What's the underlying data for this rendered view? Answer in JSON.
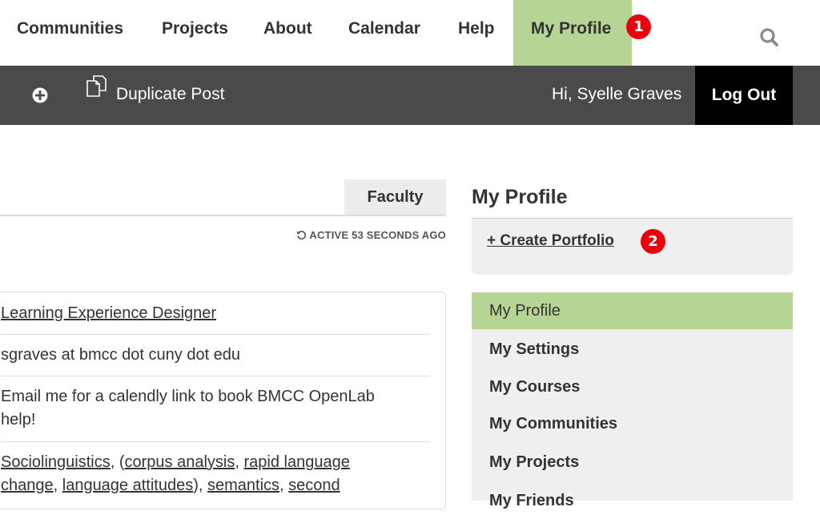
{
  "topnav": {
    "items": [
      {
        "label": "Communities"
      },
      {
        "label": "Projects"
      },
      {
        "label": "About"
      },
      {
        "label": "Calendar"
      },
      {
        "label": "Help"
      },
      {
        "label": "My Profile",
        "active": true
      }
    ],
    "profile_badge": "1",
    "search_icon": "search-icon",
    "active_color": "#b6d595"
  },
  "adminbar": {
    "add_icon": "plus-circle-icon",
    "duplicate_icon": "duplicate-icon",
    "duplicate_label": "Duplicate Post",
    "greeting": "Hi, Syelle Graves",
    "logout_label": "Log Out",
    "background": "#4a4a4a"
  },
  "profile": {
    "tab_label": "Faculty",
    "active_status": "ACTIVE 53 SECONDS AGO",
    "info": {
      "title": "Learning Experience Designer",
      "email": "sgraves at bmcc dot cuny dot edu",
      "office_hours_line1": "Email me for a calendly link to book BMCC OpenLab",
      "office_hours_line2": "help!",
      "interests_line1": [
        {
          "text": "Sociolinguistics",
          "link": true
        },
        {
          "text": ", (",
          "link": false
        },
        {
          "text": "corpus analysis",
          "link": true
        },
        {
          "text": ", ",
          "link": false
        },
        {
          "text": "rapid language",
          "link": true
        }
      ],
      "interests_line2": [
        {
          "text": "change",
          "link": true
        },
        {
          "text": ", ",
          "link": false
        },
        {
          "text": "language attitudes",
          "link": true
        },
        {
          "text": "), ",
          "link": false
        },
        {
          "text": "semantics",
          "link": true
        },
        {
          "text": ", ",
          "link": false
        },
        {
          "text": "second",
          "link": true
        }
      ]
    }
  },
  "sidebar": {
    "title": "My Profile",
    "create_portfolio": "+ Create Portfolio",
    "create_badge": "2",
    "menu": [
      {
        "label": "My Profile",
        "active": true
      },
      {
        "label": "My Settings"
      },
      {
        "label": "My Courses"
      },
      {
        "label": "My Communities"
      },
      {
        "label": "My Projects"
      },
      {
        "label": "My Friends"
      }
    ]
  }
}
